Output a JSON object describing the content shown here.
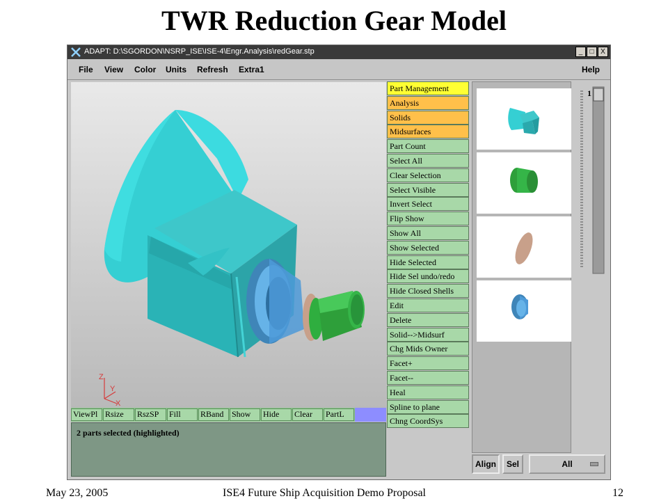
{
  "slide": {
    "title": "TWR Reduction Gear Model",
    "footer_left": "May 23, 2005",
    "footer_center": "ISE4 Future Ship Acquisition Demo Proposal",
    "footer_right": "12"
  },
  "window": {
    "title": "ADAPT: D:\\SGORDON\\NSRP_ISE\\ISE-4\\Engr.Analysis\\redGear.stp",
    "min_glyph": "_",
    "max_glyph": "□",
    "close_glyph": "X"
  },
  "menu": {
    "file": "File",
    "view": "View",
    "color": "Color",
    "units": "Units",
    "refresh": "Refresh",
    "extra1": "Extra1",
    "help": "Help"
  },
  "axes": {
    "z": "Z",
    "y": "Y",
    "x": "X"
  },
  "function_bar": {
    "buttons": [
      "ViewPl",
      "Rsize",
      "RszSP",
      "Fill",
      "RBand",
      "Show",
      "Hide",
      "Clear",
      "PartL"
    ]
  },
  "status": {
    "message": "2 parts selected (highlighted)"
  },
  "command_panel": {
    "buttons": [
      "Part Management",
      "Analysis",
      "Solids",
      "Midsurfaces",
      "Part Count",
      "Select All",
      "Clear Selection",
      "Select Visible",
      "Invert Select",
      "Flip Show",
      "Show All",
      "Show Selected",
      "Hide Selected",
      "Hide Sel undo/redo",
      "Hide Closed Shells",
      "Edit",
      "Delete",
      "Solid-->Midsurf",
      "Chg Mids Owner",
      "Facet+",
      "Facet--",
      "Heal",
      "Spline to plane",
      "Chng CoordSys"
    ],
    "colors": {
      "active": "#ffff33",
      "category": "#ffc04a",
      "action": "#a8d8a8"
    }
  },
  "scroll": {
    "value": "1"
  },
  "bottom_controls": {
    "align": "Align",
    "sel": "Sel",
    "all": "All"
  },
  "colors": {
    "cyan_part": "#3fd6d6",
    "green_part": "#2fae3f",
    "blue_part": "#4d9ad8",
    "tan_part": "#c8a08a"
  }
}
